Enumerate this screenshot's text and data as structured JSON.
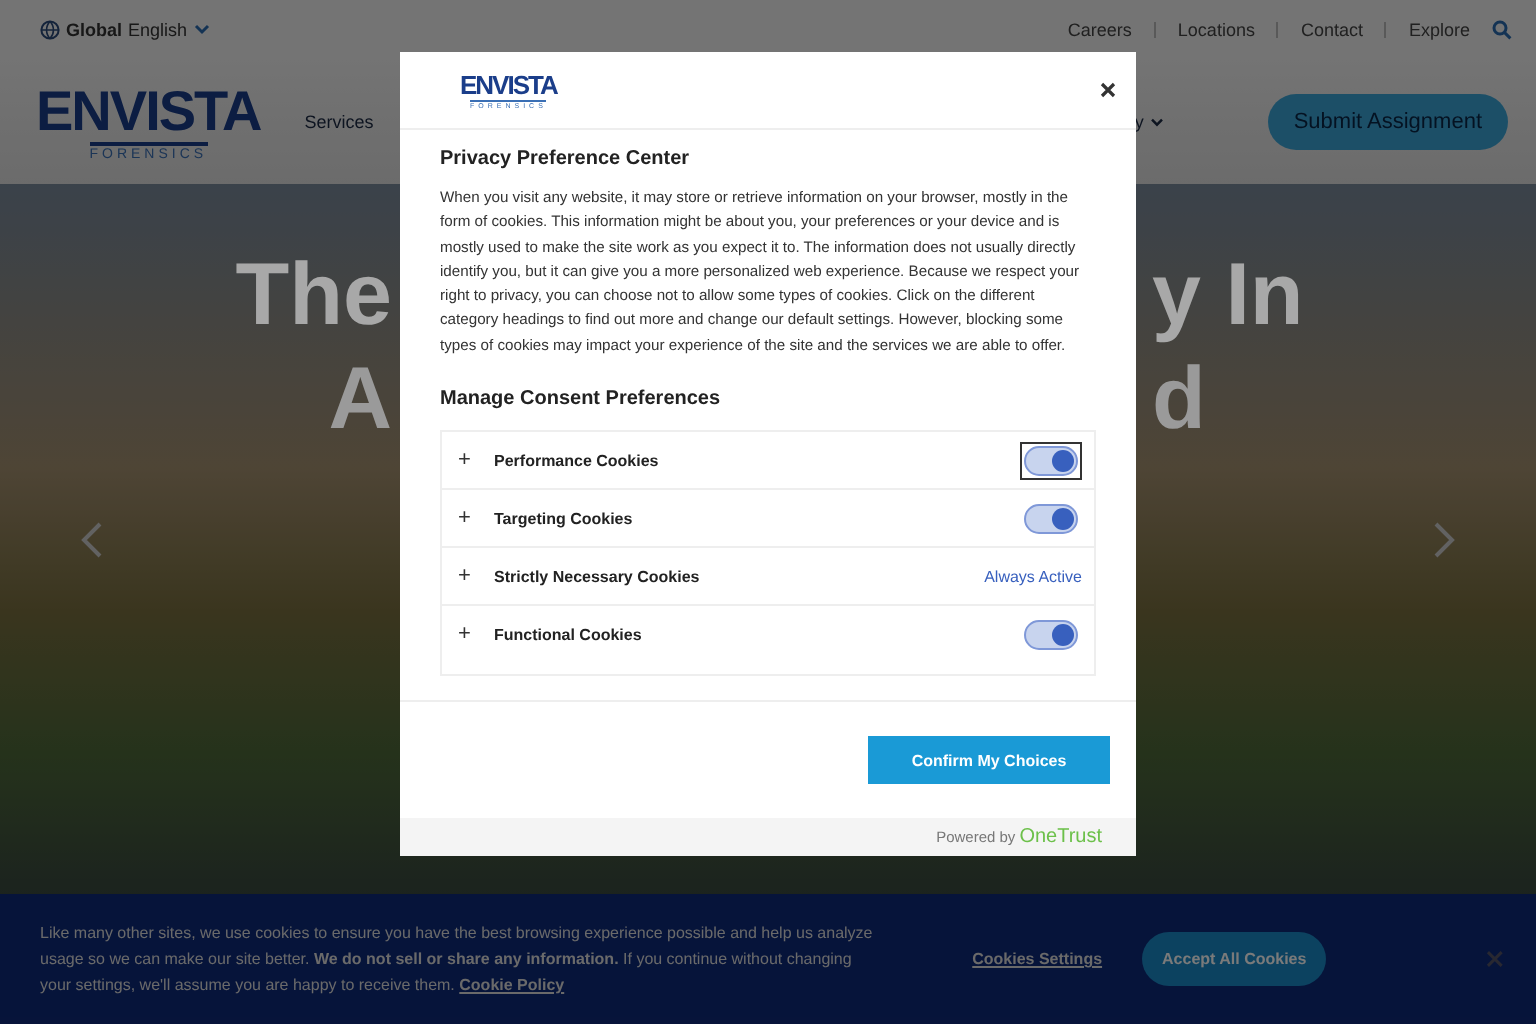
{
  "top_bar": {
    "region": "Global",
    "language": "English",
    "links": [
      "Careers",
      "Locations",
      "Contact",
      "Explore"
    ]
  },
  "header": {
    "logo": {
      "word": "ENVISTA",
      "sub": "FORENSICS"
    },
    "nav_items": [
      "Services",
      "y"
    ],
    "cta": "Submit Assignment"
  },
  "hero": {
    "line_1": [
      "The",
      "y In"
    ],
    "line_2": [
      "A",
      "d"
    ]
  },
  "modal": {
    "logo": {
      "word": "ENVISTA",
      "sub": "FORENSICS"
    },
    "title": "Privacy Preference Center",
    "description": "When you visit any website, it may store or retrieve information on your browser, mostly in the form of cookies. This information might be about you, your preferences or your device and is mostly used to make the site work as you expect it to. The information does not usually directly identify you, but it can give you a more personalized web experience. Because we respect your right to privacy, you can choose not to allow some types of cookies. Click on the different category headings to find out more and change our default settings. However, blocking some types of cookies may impact your experience of the site and the services we are able to offer.",
    "section_title": "Manage Consent Preferences",
    "categories": [
      {
        "label": "Performance Cookies",
        "kind": "toggle",
        "on": true,
        "focused": true,
        "expander": "+"
      },
      {
        "label": "Targeting Cookies",
        "kind": "toggle",
        "on": true,
        "focused": false,
        "expander": "+"
      },
      {
        "label": "Strictly Necessary Cookies",
        "kind": "status",
        "status": "Always Active",
        "expander": "+"
      },
      {
        "label": "Functional Cookies",
        "kind": "toggle",
        "on": true,
        "focused": false,
        "expander": "+"
      }
    ],
    "confirm_button": "Confirm My Choices",
    "powered_by": "Powered by",
    "brand": "OneTrust"
  },
  "cookie_banner": {
    "text": "Like many other sites, we use cookies to ensure you have the best browsing experience possible and help us analyze usage so we can make our site better. **We do not sell or share any information.** If you continue without changing your settings, we'll assume you are happy to receive them.",
    "policy_link": "Cookie Policy",
    "settings_link": "Cookies Settings",
    "accept_button": "Accept All Cookies"
  }
}
